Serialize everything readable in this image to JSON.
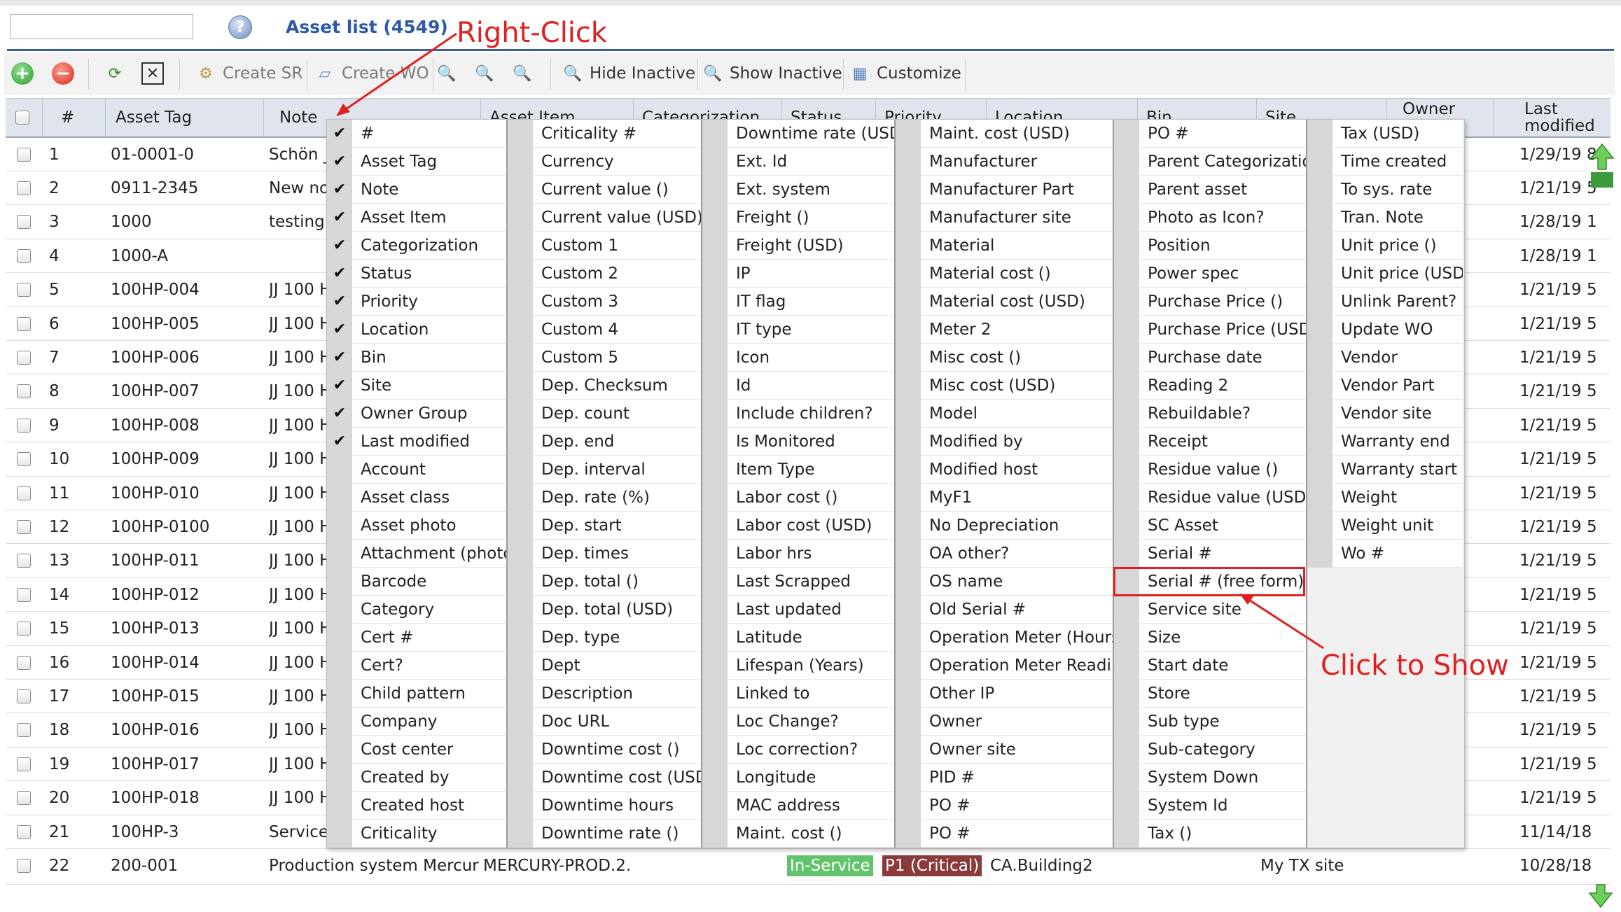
{
  "header": {
    "title": "Asset list (4549)",
    "search_value": ""
  },
  "toolbar": {
    "create_sr": "Create SR",
    "create_wo": "Create WO",
    "hide_inactive": "Hide Inactive",
    "show_inactive": "Show Inactive",
    "customize": "Customize"
  },
  "columns": {
    "num": "#",
    "asset_tag": "Asset Tag",
    "note": "Note",
    "asset_item": "Asset Item",
    "categorization": "Categorization",
    "status": "Status",
    "priority": "Priority",
    "location": "Location",
    "bin": "Bin",
    "site": "Site",
    "owner_group": "Owner",
    "last_modified": "Last modified"
  },
  "rows": [
    {
      "num": "1",
      "tag": "01-0001-0",
      "note": "Schön _",
      "mod": "1/29/19 8"
    },
    {
      "num": "2",
      "tag": "0911-2345",
      "note": "New not",
      "mod": "1/21/19 5"
    },
    {
      "num": "3",
      "tag": "1000",
      "note": "testing i",
      "mod": "1/28/19 1"
    },
    {
      "num": "4",
      "tag": "1000-A",
      "note": "",
      "mod": "1/28/19 1"
    },
    {
      "num": "5",
      "tag": "100HP-004",
      "note": "JJ 100 H",
      "mod": "1/21/19 5"
    },
    {
      "num": "6",
      "tag": "100HP-005",
      "note": "JJ 100 H",
      "mod": "1/21/19 5"
    },
    {
      "num": "7",
      "tag": "100HP-006",
      "note": "JJ 100 H",
      "mod": "1/21/19 5"
    },
    {
      "num": "8",
      "tag": "100HP-007",
      "note": "JJ 100 H",
      "mod": "1/21/19 5"
    },
    {
      "num": "9",
      "tag": "100HP-008",
      "note": "JJ 100 H",
      "mod": "1/21/19 5"
    },
    {
      "num": "10",
      "tag": "100HP-009",
      "note": "JJ 100 H",
      "mod": "1/21/19 5"
    },
    {
      "num": "11",
      "tag": "100HP-010",
      "note": "JJ 100 H",
      "mod": "1/21/19 5"
    },
    {
      "num": "12",
      "tag": "100HP-0100",
      "note": "JJ 100 H",
      "mod": "1/21/19 5"
    },
    {
      "num": "13",
      "tag": "100HP-011",
      "note": "JJ 100 H",
      "mod": "1/21/19 5"
    },
    {
      "num": "14",
      "tag": "100HP-012",
      "note": "JJ 100 H",
      "mod": "1/21/19 5"
    },
    {
      "num": "15",
      "tag": "100HP-013",
      "note": "JJ 100 H",
      "mod": "1/21/19 5"
    },
    {
      "num": "16",
      "tag": "100HP-014",
      "note": "JJ 100 H",
      "mod": "1/21/19 5"
    },
    {
      "num": "17",
      "tag": "100HP-015",
      "note": "JJ 100 H",
      "mod": "1/21/19 5"
    },
    {
      "num": "18",
      "tag": "100HP-016",
      "note": "JJ 100 H",
      "mod": "1/21/19 5"
    },
    {
      "num": "19",
      "tag": "100HP-017",
      "note": "JJ 100 H",
      "mod": "1/21/19 5"
    },
    {
      "num": "20",
      "tag": "100HP-018",
      "note": "JJ 100 H",
      "mod": "1/21/19 5"
    },
    {
      "num": "21",
      "tag": "100HP-3",
      "note": "Service",
      "mod": "11/14/18"
    }
  ],
  "last_row": {
    "num": "22",
    "tag": "200-001",
    "note": "Production system Mercur...",
    "item": "MERCURY-PROD.2...",
    "status": "In-Service",
    "priority": "P1 (Critical)",
    "location": "CA.Building2",
    "site": "My TX site",
    "mod": "10/28/18"
  },
  "menu_columns": [
    [
      {
        "label": "#",
        "checked": true
      },
      {
        "label": "Asset Tag",
        "checked": true
      },
      {
        "label": "Note",
        "checked": true
      },
      {
        "label": "Asset Item",
        "checked": true
      },
      {
        "label": "Categorization",
        "checked": true
      },
      {
        "label": "Status",
        "checked": true
      },
      {
        "label": "Priority",
        "checked": true
      },
      {
        "label": "Location",
        "checked": true
      },
      {
        "label": "Bin",
        "checked": true
      },
      {
        "label": "Site",
        "checked": true
      },
      {
        "label": "Owner Group",
        "checked": true
      },
      {
        "label": "Last modified",
        "checked": true
      },
      {
        "label": "Account",
        "checked": false
      },
      {
        "label": "Asset class",
        "checked": false
      },
      {
        "label": "Asset photo",
        "checked": false
      },
      {
        "label": "Attachment (photo)",
        "checked": false
      },
      {
        "label": "Barcode",
        "checked": false
      },
      {
        "label": "Category",
        "checked": false
      },
      {
        "label": "Cert #",
        "checked": false
      },
      {
        "label": "Cert?",
        "checked": false
      },
      {
        "label": "Child pattern",
        "checked": false
      },
      {
        "label": "Company",
        "checked": false
      },
      {
        "label": "Cost center",
        "checked": false
      },
      {
        "label": "Created by",
        "checked": false
      },
      {
        "label": "Created host",
        "checked": false
      },
      {
        "label": "Criticality",
        "checked": false
      }
    ],
    [
      {
        "label": "Criticality #"
      },
      {
        "label": "Currency"
      },
      {
        "label": "Current value ()"
      },
      {
        "label": "Current value (USD)"
      },
      {
        "label": "Custom 1"
      },
      {
        "label": "Custom 2"
      },
      {
        "label": "Custom 3"
      },
      {
        "label": "Custom 4"
      },
      {
        "label": "Custom 5"
      },
      {
        "label": "Dep. Checksum"
      },
      {
        "label": "Dep. count"
      },
      {
        "label": "Dep. end"
      },
      {
        "label": "Dep. interval"
      },
      {
        "label": "Dep. rate (%)"
      },
      {
        "label": "Dep. start"
      },
      {
        "label": "Dep. times"
      },
      {
        "label": "Dep. total ()"
      },
      {
        "label": "Dep. total (USD)"
      },
      {
        "label": "Dep. type"
      },
      {
        "label": "Dept"
      },
      {
        "label": "Description"
      },
      {
        "label": "Doc URL"
      },
      {
        "label": "Downtime cost ()"
      },
      {
        "label": "Downtime cost (USD)"
      },
      {
        "label": "Downtime hours"
      },
      {
        "label": "Downtime rate ()"
      }
    ],
    [
      {
        "label": "Downtime rate (USD)"
      },
      {
        "label": "Ext. Id"
      },
      {
        "label": "Ext. system"
      },
      {
        "label": "Freight ()"
      },
      {
        "label": "Freight (USD)"
      },
      {
        "label": "IP"
      },
      {
        "label": "IT flag"
      },
      {
        "label": "IT type"
      },
      {
        "label": "Icon"
      },
      {
        "label": "Id"
      },
      {
        "label": "Include children?"
      },
      {
        "label": "Is Monitored"
      },
      {
        "label": "Item Type"
      },
      {
        "label": "Labor cost ()"
      },
      {
        "label": "Labor cost (USD)"
      },
      {
        "label": "Labor hrs"
      },
      {
        "label": "Last Scrapped"
      },
      {
        "label": "Last updated"
      },
      {
        "label": "Latitude"
      },
      {
        "label": "Lifespan (Years)"
      },
      {
        "label": "Linked to"
      },
      {
        "label": "Loc Change?"
      },
      {
        "label": "Loc correction?"
      },
      {
        "label": "Longitude"
      },
      {
        "label": "MAC address"
      },
      {
        "label": "Maint. cost ()"
      }
    ],
    [
      {
        "label": "Maint. cost (USD)"
      },
      {
        "label": "Manufacturer"
      },
      {
        "label": "Manufacturer Part"
      },
      {
        "label": "Manufacturer site"
      },
      {
        "label": "Material"
      },
      {
        "label": "Material cost ()"
      },
      {
        "label": "Material cost (USD)"
      },
      {
        "label": "Meter 2"
      },
      {
        "label": "Misc cost ()"
      },
      {
        "label": "Misc cost (USD)"
      },
      {
        "label": "Model"
      },
      {
        "label": "Modified by"
      },
      {
        "label": "Modified host"
      },
      {
        "label": "MyF1"
      },
      {
        "label": "No Depreciation"
      },
      {
        "label": "OA other?"
      },
      {
        "label": "OS name"
      },
      {
        "label": "Old Serial #"
      },
      {
        "label": "Operation Meter (Hours)"
      },
      {
        "label": "Operation Meter Reading"
      },
      {
        "label": "Other IP"
      },
      {
        "label": "Owner"
      },
      {
        "label": "Owner site"
      },
      {
        "label": "PID #"
      },
      {
        "label": "PO #"
      },
      {
        "label": "PO #"
      }
    ],
    [
      {
        "label": "PO #"
      },
      {
        "label": "Parent Categorization"
      },
      {
        "label": "Parent asset"
      },
      {
        "label": "Photo as Icon?"
      },
      {
        "label": "Position"
      },
      {
        "label": "Power spec"
      },
      {
        "label": "Purchase Price ()"
      },
      {
        "label": "Purchase Price (USD)"
      },
      {
        "label": "Purchase date"
      },
      {
        "label": "Reading 2"
      },
      {
        "label": "Rebuildable?"
      },
      {
        "label": "Receipt"
      },
      {
        "label": "Residue value ()"
      },
      {
        "label": "Residue value (USD)"
      },
      {
        "label": "SC Asset"
      },
      {
        "label": "Serial #"
      },
      {
        "label": "Serial # (free form)"
      },
      {
        "label": "Service site"
      },
      {
        "label": "Size"
      },
      {
        "label": "Start date"
      },
      {
        "label": "Store"
      },
      {
        "label": "Sub type"
      },
      {
        "label": "Sub-category"
      },
      {
        "label": "System Down"
      },
      {
        "label": "System Id"
      },
      {
        "label": "Tax ()"
      }
    ],
    [
      {
        "label": "Tax (USD)"
      },
      {
        "label": "Time created"
      },
      {
        "label": "To sys. rate"
      },
      {
        "label": "Tran. Note"
      },
      {
        "label": "Unit price ()"
      },
      {
        "label": "Unit price (USD)"
      },
      {
        "label": "Unlink Parent?"
      },
      {
        "label": "Update WO"
      },
      {
        "label": "Vendor"
      },
      {
        "label": "Vendor Part"
      },
      {
        "label": "Vendor site"
      },
      {
        "label": "Warranty end"
      },
      {
        "label": "Warranty start"
      },
      {
        "label": "Weight"
      },
      {
        "label": "Weight unit"
      },
      {
        "label": "Wo #"
      }
    ]
  ],
  "annotations": {
    "right_click": "Right-Click",
    "click_to_show": "Click to Show"
  },
  "colors": {
    "annotation": "#e02020",
    "title": "#2d5aa8",
    "in_service": "#63c36c",
    "p1": "#8a3a3a"
  }
}
